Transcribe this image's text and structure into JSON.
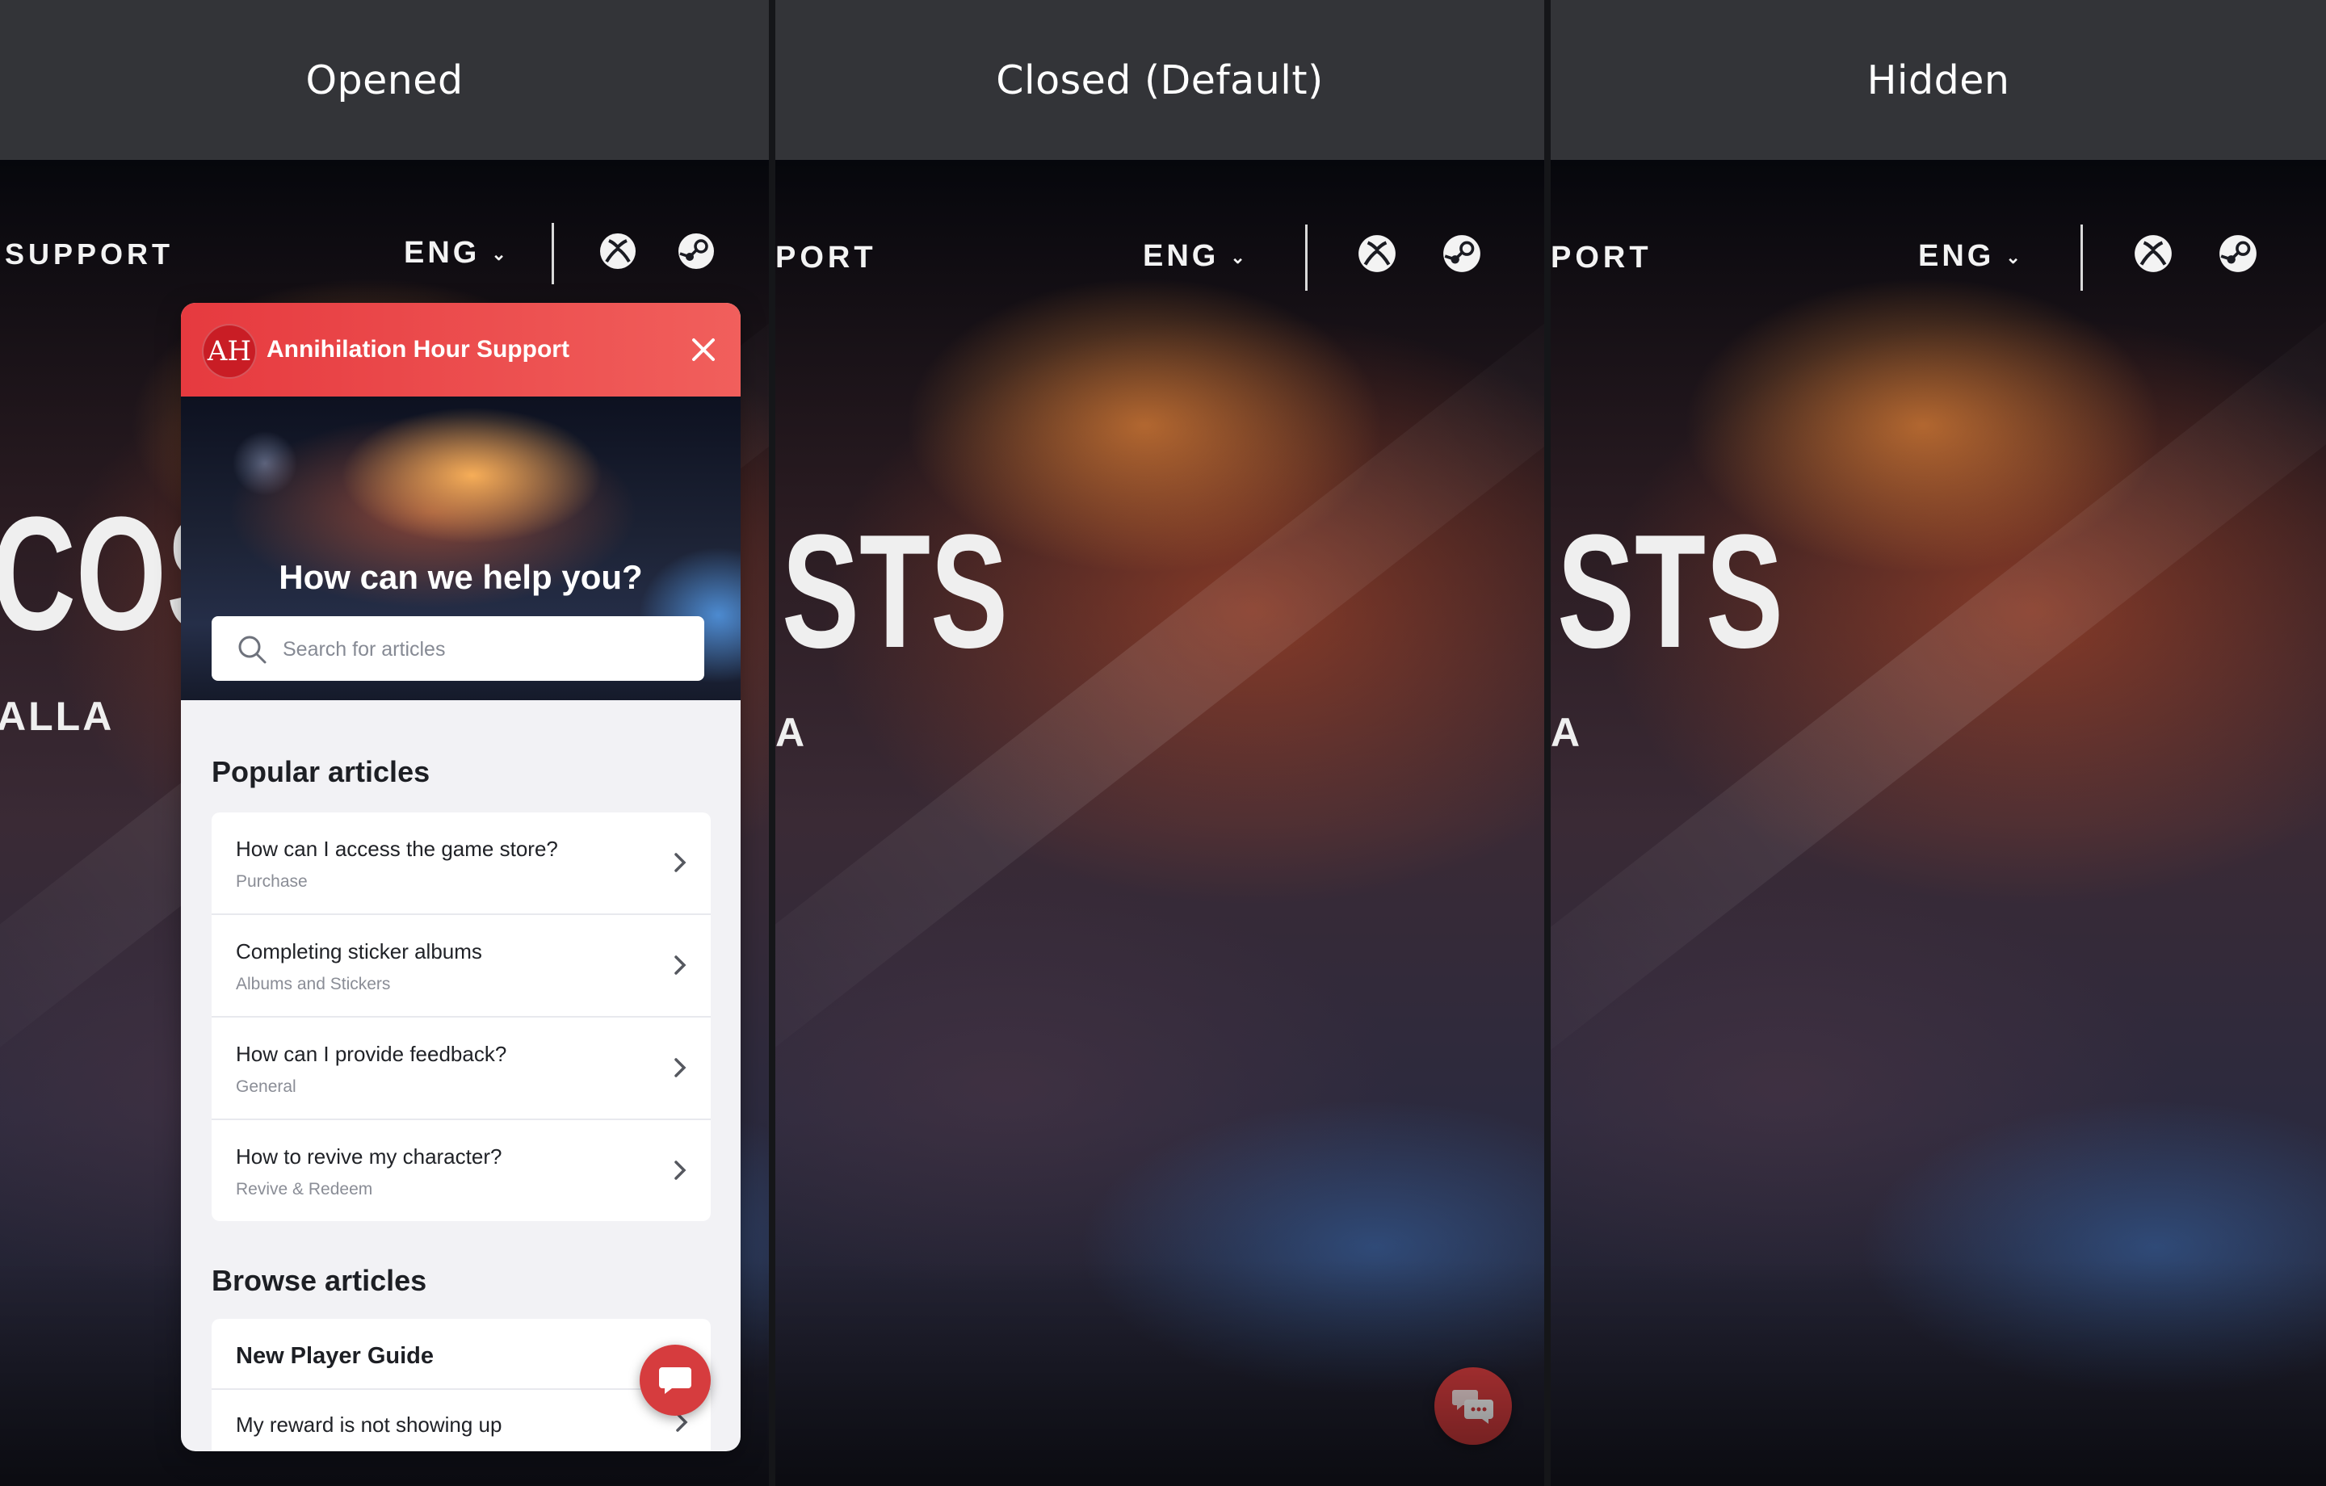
{
  "columns": [
    {
      "label": "Opened"
    },
    {
      "label": "Closed (Default)"
    },
    {
      "label": "Hidden"
    }
  ],
  "site_nav": {
    "support_label_full": "SUPPORT",
    "support_label_cropped": "PORT",
    "language": "ENG",
    "platform_icons": [
      "xbox-icon",
      "steam-icon"
    ]
  },
  "hero": {
    "col1_title_fragment": "COST",
    "col1_subtitle_fragment": "ALLA",
    "col23_title_fragment": "STS",
    "col23_subtitle_fragment": "A"
  },
  "widget": {
    "logo_text": "AH",
    "header_title": "Annihilation Hour Support",
    "hero_title": "How can we help you?",
    "search_placeholder": "Search for articles",
    "popular_heading": "Popular articles",
    "popular_articles": [
      {
        "title": "How can I access the game store?",
        "category": "Purchase"
      },
      {
        "title": "Completing sticker albums",
        "category": "Albums and Stickers"
      },
      {
        "title": "How can I provide feedback?",
        "category": "General"
      },
      {
        "title": "How to revive my character?",
        "category": "Revive & Redeem"
      }
    ],
    "browse_heading": "Browse articles",
    "browse_section": "New Player Guide",
    "browse_items": [
      {
        "title": "My reward is not showing up"
      }
    ]
  },
  "colors": {
    "accent": "#e63a3f",
    "fab": "#d63c3e",
    "column_header_bg": "#333438"
  }
}
